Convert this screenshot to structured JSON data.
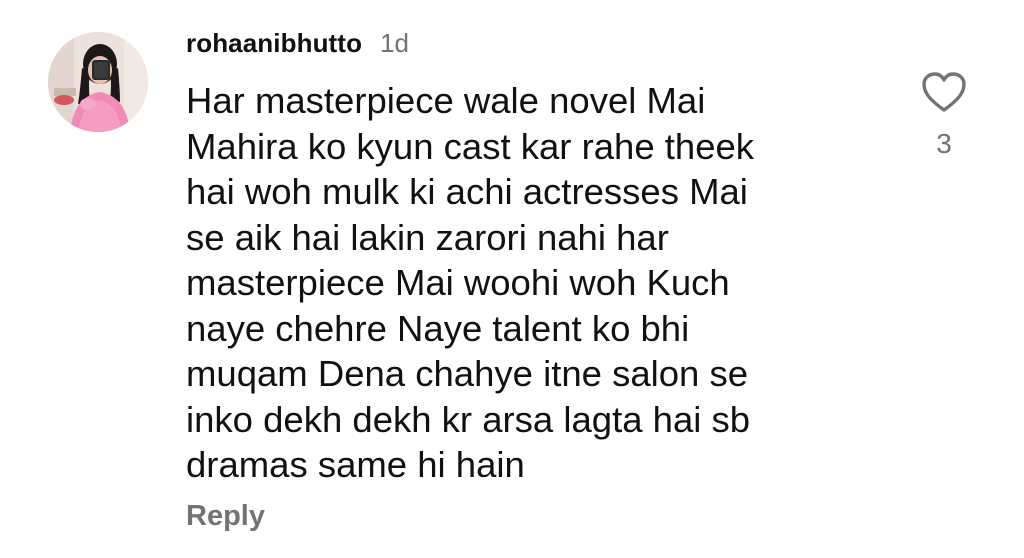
{
  "comment": {
    "username": "rohaanibhutto",
    "time": "1d",
    "text": "Har masterpiece wale novel Mai\nMahira ko kyun cast kar rahe theek\nhai woh mulk ki achi actresses Mai\nse aik hai lakin zarori nahi har\nmasterpiece Mai woohi woh Kuch\nnaye chehre Naye talent ko bhi\nmuqam Dena chahye itne salon se\ninko dekh dekh kr arsa lagta hai sb\ndramas same hi hain",
    "reply_label": "Reply",
    "like_count": "3",
    "like_icon": "heart-outline-icon"
  },
  "colors": {
    "text": "#111111",
    "secondary": "#737373",
    "background": "#ffffff",
    "avatar_accent": "#f08ab6"
  }
}
